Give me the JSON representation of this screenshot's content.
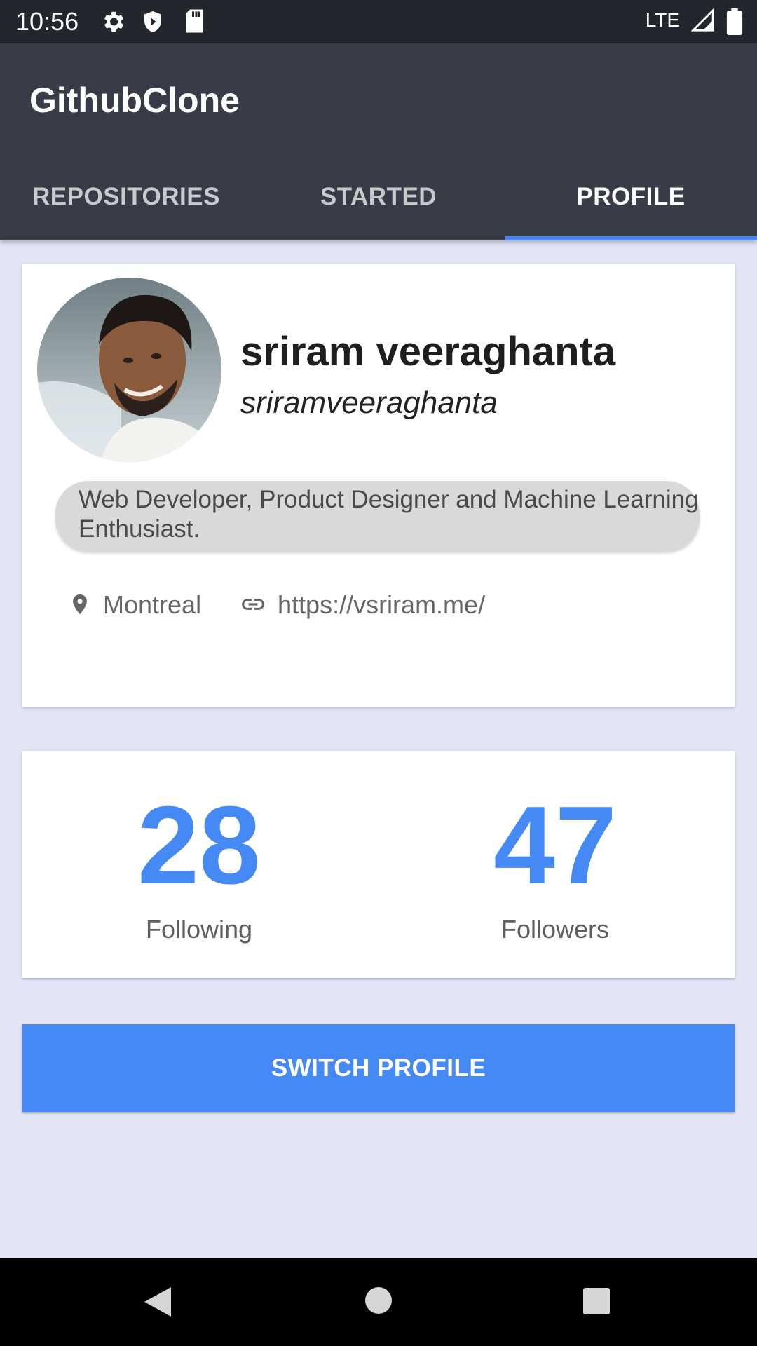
{
  "status_bar": {
    "time": "10:56",
    "network": "LTE",
    "icons": [
      "settings-icon",
      "shield-icon",
      "sd-card-icon",
      "signal-icon",
      "battery-icon"
    ]
  },
  "app_bar": {
    "title": "GithubClone",
    "tabs": [
      {
        "label": "REPOSITORIES",
        "active": false
      },
      {
        "label": "STARTED",
        "active": false
      },
      {
        "label": "PROFILE",
        "active": true
      }
    ]
  },
  "profile": {
    "name": "sriram veeraghanta",
    "username": "sriramveeraghanta",
    "bio": "Web Developer, Product Designer and Machine Learning Enthusiast.",
    "location": "Montreal",
    "website": "https://vsriram.me/"
  },
  "stats": {
    "following_count": "28",
    "following_label": "Following",
    "followers_count": "47",
    "followers_label": "Followers"
  },
  "actions": {
    "switch_profile_label": "SWITCH PROFILE"
  },
  "colors": {
    "accent": "#4589f5",
    "app_bar": "#393c47",
    "background": "#e3e5f6"
  }
}
